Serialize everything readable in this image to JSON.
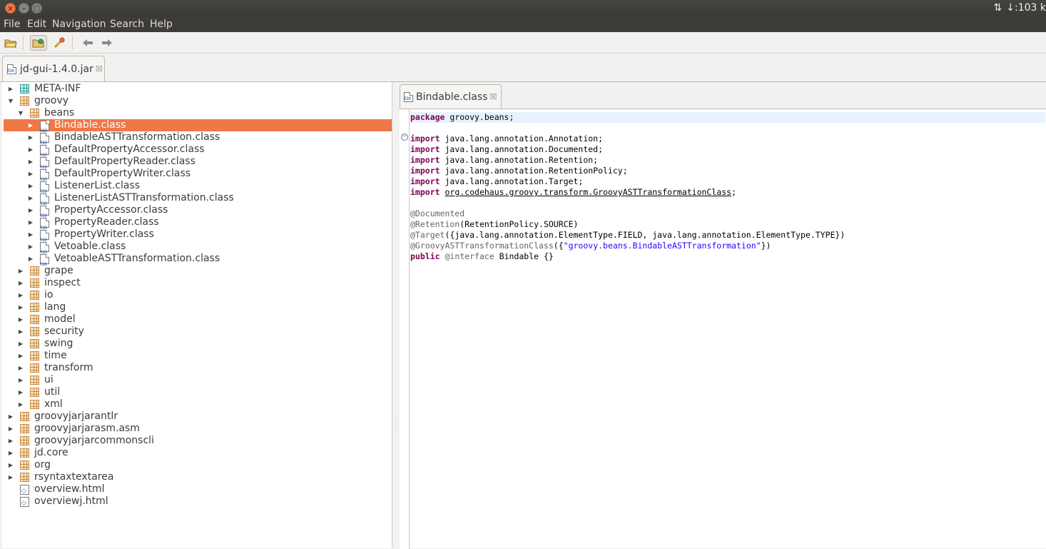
{
  "window": {
    "close_glyph": "×",
    "min_glyph": "–",
    "max_glyph": "□",
    "network_arrows": "⇅",
    "download_rate": "↓:103 k"
  },
  "menu": [
    "File",
    "Edit",
    "Navigation",
    "Search",
    "Help"
  ],
  "toolbar": {
    "icons": [
      "open-file-icon",
      "open-type-icon",
      "search-type-icon",
      "back-arrow-icon",
      "forward-arrow-icon"
    ]
  },
  "main_tab": {
    "label": "jd-gui-1.4.0.jar",
    "close": "☒"
  },
  "tree": [
    {
      "label": "META-INF",
      "depth": 0,
      "expander": "▶",
      "icon": "teal-package"
    },
    {
      "label": "groovy",
      "depth": 0,
      "expander": "▼",
      "icon": "package"
    },
    {
      "label": "beans",
      "depth": 1,
      "expander": "▼",
      "icon": "package"
    },
    {
      "label": "Bindable.class",
      "depth": 2,
      "expander": "▶",
      "icon": "class",
      "selected": true
    },
    {
      "label": "BindableASTTransformation.class",
      "depth": 2,
      "expander": "▶",
      "icon": "class"
    },
    {
      "label": "DefaultPropertyAccessor.class",
      "depth": 2,
      "expander": "▶",
      "icon": "class"
    },
    {
      "label": "DefaultPropertyReader.class",
      "depth": 2,
      "expander": "▶",
      "icon": "class"
    },
    {
      "label": "DefaultPropertyWriter.class",
      "depth": 2,
      "expander": "▶",
      "icon": "class"
    },
    {
      "label": "ListenerList.class",
      "depth": 2,
      "expander": "▶",
      "icon": "class"
    },
    {
      "label": "ListenerListASTTransformation.class",
      "depth": 2,
      "expander": "▶",
      "icon": "class"
    },
    {
      "label": "PropertyAccessor.class",
      "depth": 2,
      "expander": "▶",
      "icon": "class"
    },
    {
      "label": "PropertyReader.class",
      "depth": 2,
      "expander": "▶",
      "icon": "class"
    },
    {
      "label": "PropertyWriter.class",
      "depth": 2,
      "expander": "▶",
      "icon": "class"
    },
    {
      "label": "Vetoable.class",
      "depth": 2,
      "expander": "▶",
      "icon": "class"
    },
    {
      "label": "VetoableASTTransformation.class",
      "depth": 2,
      "expander": "▶",
      "icon": "class"
    },
    {
      "label": "grape",
      "depth": 1,
      "expander": "▶",
      "icon": "package"
    },
    {
      "label": "inspect",
      "depth": 1,
      "expander": "▶",
      "icon": "package"
    },
    {
      "label": "io",
      "depth": 1,
      "expander": "▶",
      "icon": "package"
    },
    {
      "label": "lang",
      "depth": 1,
      "expander": "▶",
      "icon": "package"
    },
    {
      "label": "model",
      "depth": 1,
      "expander": "▶",
      "icon": "package"
    },
    {
      "label": "security",
      "depth": 1,
      "expander": "▶",
      "icon": "package"
    },
    {
      "label": "swing",
      "depth": 1,
      "expander": "▶",
      "icon": "package"
    },
    {
      "label": "time",
      "depth": 1,
      "expander": "▶",
      "icon": "package"
    },
    {
      "label": "transform",
      "depth": 1,
      "expander": "▶",
      "icon": "package"
    },
    {
      "label": "ui",
      "depth": 1,
      "expander": "▶",
      "icon": "package"
    },
    {
      "label": "util",
      "depth": 1,
      "expander": "▶",
      "icon": "package"
    },
    {
      "label": "xml",
      "depth": 1,
      "expander": "▶",
      "icon": "package"
    },
    {
      "label": "groovyjarjarantlr",
      "depth": 0,
      "expander": "▶",
      "icon": "package"
    },
    {
      "label": "groovyjarjarasm.asm",
      "depth": 0,
      "expander": "▶",
      "icon": "package"
    },
    {
      "label": "groovyjarjarcommonscli",
      "depth": 0,
      "expander": "▶",
      "icon": "package"
    },
    {
      "label": "jd.core",
      "depth": 0,
      "expander": "▶",
      "icon": "package"
    },
    {
      "label": "org",
      "depth": 0,
      "expander": "▶",
      "icon": "package"
    },
    {
      "label": "rsyntaxtextarea",
      "depth": 0,
      "expander": "▶",
      "icon": "package"
    },
    {
      "label": "overview.html",
      "depth": 0,
      "expander": "",
      "icon": "html"
    },
    {
      "label": "overviewj.html",
      "depth": 0,
      "expander": "",
      "icon": "html"
    }
  ],
  "editor_tab": {
    "label": "Bindable.class",
    "close": "☒"
  },
  "fold_glyph": "−",
  "code": [
    [
      [
        "kw",
        "package"
      ],
      [
        "t",
        " groovy.beans;"
      ]
    ],
    [],
    [
      [
        "kw",
        "import"
      ],
      [
        "t",
        " java.lang.annotation.Annotation;"
      ]
    ],
    [
      [
        "kw",
        "import"
      ],
      [
        "t",
        " java.lang.annotation.Documented;"
      ]
    ],
    [
      [
        "kw",
        "import"
      ],
      [
        "t",
        " java.lang.annotation.Retention;"
      ]
    ],
    [
      [
        "kw",
        "import"
      ],
      [
        "t",
        " java.lang.annotation.RetentionPolicy;"
      ]
    ],
    [
      [
        "kw",
        "import"
      ],
      [
        "t",
        " java.lang.annotation.Target;"
      ]
    ],
    [
      [
        "kw",
        "import"
      ],
      [
        "t",
        " "
      ],
      [
        "lnk",
        "org.codehaus.groovy.transform.GroovyASTTransformationClass"
      ],
      [
        "t",
        ";"
      ]
    ],
    [],
    [
      [
        "an",
        "@Documented"
      ]
    ],
    [
      [
        "an",
        "@Retention"
      ],
      [
        "t",
        "(RetentionPolicy.SOURCE)"
      ]
    ],
    [
      [
        "an",
        "@Target"
      ],
      [
        "t",
        "({java.lang.annotation.ElementType.FIELD, java.lang.annotation.ElementType.TYPE})"
      ]
    ],
    [
      [
        "an",
        "@GroovyASTTransformationClass"
      ],
      [
        "t",
        "({"
      ],
      [
        "str",
        "\"groovy.beans.BindableASTTransformation\""
      ],
      [
        "t",
        "})"
      ]
    ],
    [
      [
        "kw",
        "public"
      ],
      [
        "t",
        " "
      ],
      [
        "an",
        "@interface"
      ],
      [
        "t",
        " Bindable {}"
      ]
    ]
  ]
}
